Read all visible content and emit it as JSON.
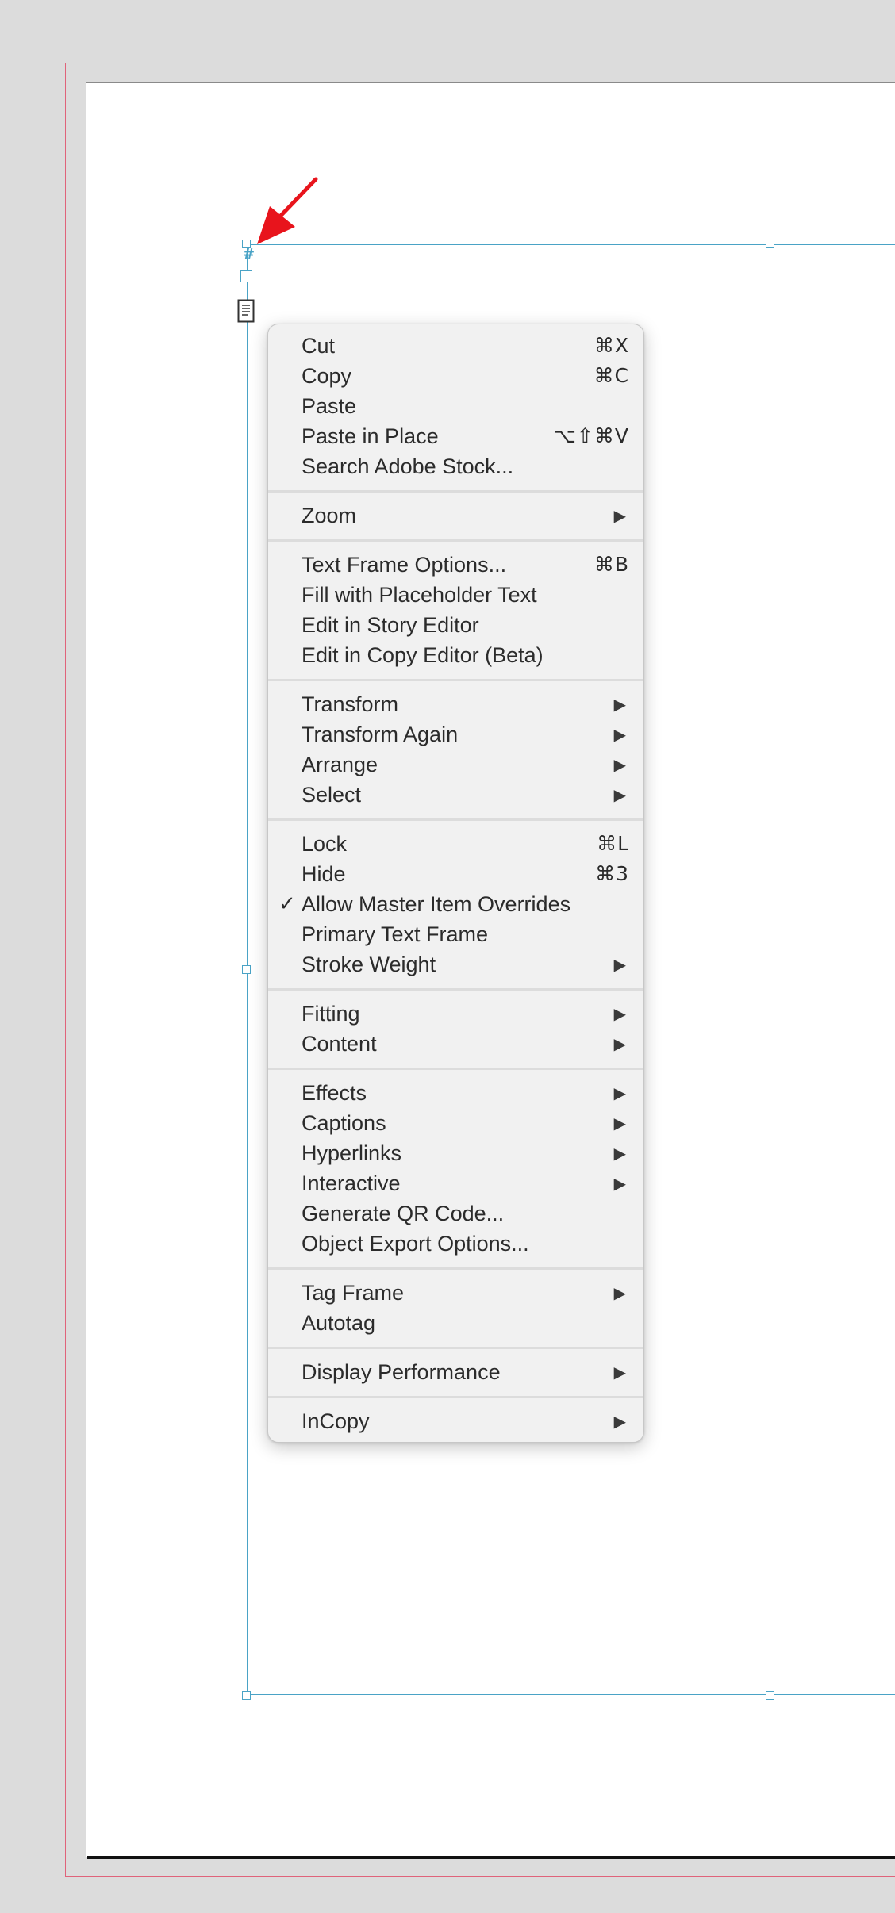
{
  "frame": {
    "hash_label": "#"
  },
  "context_menu": {
    "groups": [
      [
        {
          "label": "Cut",
          "shortcut": "⌘X"
        },
        {
          "label": "Copy",
          "shortcut": "⌘C"
        },
        {
          "label": "Paste"
        },
        {
          "label": "Paste in Place",
          "shortcut": "⌥⇧⌘V"
        },
        {
          "label": "Search Adobe Stock..."
        }
      ],
      [
        {
          "label": "Zoom",
          "submenu": true
        }
      ],
      [
        {
          "label": "Text Frame Options...",
          "shortcut": "⌘B"
        },
        {
          "label": "Fill with Placeholder Text"
        },
        {
          "label": "Edit in Story Editor"
        },
        {
          "label": "Edit in Copy Editor (Beta)"
        }
      ],
      [
        {
          "label": "Transform",
          "submenu": true
        },
        {
          "label": "Transform Again",
          "submenu": true
        },
        {
          "label": "Arrange",
          "submenu": true
        },
        {
          "label": "Select",
          "submenu": true
        }
      ],
      [
        {
          "label": "Lock",
          "shortcut": "⌘L"
        },
        {
          "label": "Hide",
          "shortcut": "⌘3"
        },
        {
          "label": "Allow Master Item Overrides",
          "checked": true
        },
        {
          "label": "Primary Text Frame"
        },
        {
          "label": "Stroke Weight",
          "submenu": true
        }
      ],
      [
        {
          "label": "Fitting",
          "submenu": true
        },
        {
          "label": "Content",
          "submenu": true
        }
      ],
      [
        {
          "label": "Effects",
          "submenu": true
        },
        {
          "label": "Captions",
          "submenu": true
        },
        {
          "label": "Hyperlinks",
          "submenu": true
        },
        {
          "label": "Interactive",
          "submenu": true
        },
        {
          "label": "Generate QR Code..."
        },
        {
          "label": "Object Export Options..."
        }
      ],
      [
        {
          "label": "Tag Frame",
          "submenu": true
        },
        {
          "label": "Autotag"
        }
      ],
      [
        {
          "label": "Display Performance",
          "submenu": true
        }
      ],
      [
        {
          "label": "InCopy",
          "submenu": true
        }
      ]
    ]
  },
  "colors": {
    "frame_edge": "#4aa3c6",
    "bleed_guide": "#e0637a",
    "annotation_arrow": "#e8141c",
    "menu_background": "#f1f1f1"
  }
}
